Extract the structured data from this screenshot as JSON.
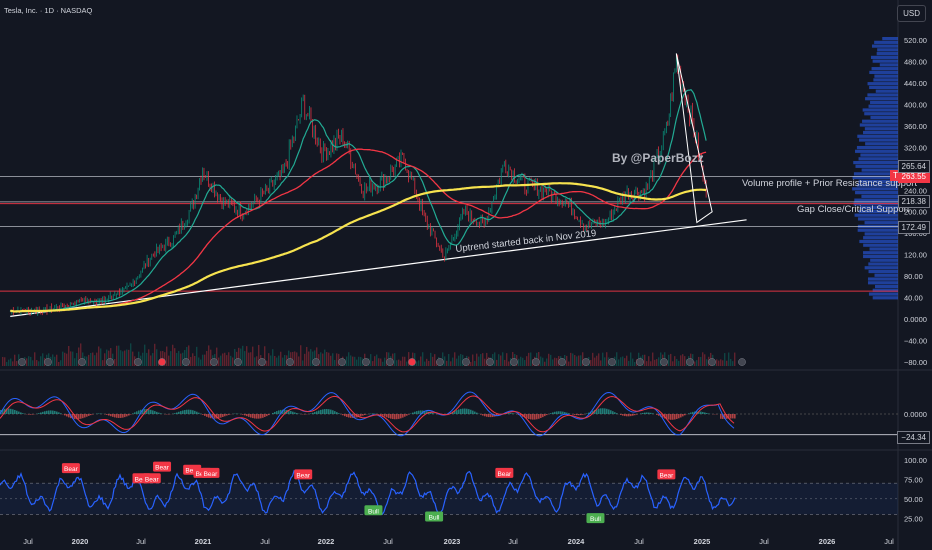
{
  "header": {
    "symbol_title": "Tesla, Inc. · 1D · NASDAQ",
    "currency": "USD"
  },
  "annotations": {
    "author": "By @PaperBozz",
    "uptrend": "Uptrend started back in Nov 2019",
    "volume_profile": "Volume profile + Prior Resistance support",
    "gap_close": "Gap Close/Critical Support"
  },
  "price_tags": {
    "current_ticker": "TSLA",
    "current": "263.55",
    "resistance": "265.64",
    "support": "218.38",
    "gap": "172.49",
    "macd_level": "−24.34"
  },
  "colors": {
    "background": "#131722",
    "price_line": "#d1d4dc",
    "ma_short": "#22ab94",
    "ma_mid": "#f23645",
    "ma_long": "#f7e34f",
    "trendline": "#ffffff",
    "horizontal_line": "#d1d4dc",
    "red_line": "#f23645",
    "volume_profile": "#2962ff",
    "rsi": "#2962ff",
    "bear_label": "#f23645",
    "bull_label": "#4caf50",
    "earnings_marker": "#f23645"
  },
  "chart_data": [
    {
      "type": "line",
      "pane": "price",
      "ylim": [
        -80,
        520
      ],
      "y_ticks": [
        "520.00",
        "480.00",
        "440.00",
        "400.00",
        "360.00",
        "320.00",
        "280.00",
        "240.00",
        "200.00",
        "160.00",
        "120.00",
        "80.00",
        "40.00",
        "0.0000",
        "−40.00",
        "−80.00"
      ],
      "x_ticks": [
        "Jul",
        "2020",
        "Jul",
        "2021",
        "Jul",
        "2022",
        "Jul",
        "2023",
        "Jul",
        "2024",
        "Jul",
        "2025",
        "Jul",
        "2026",
        "Jul"
      ],
      "series": [
        {
          "x": [
            "2019-06",
            "2019-09",
            "2019-11",
            "2020-01",
            "2020-03",
            "2020-06",
            "2020-08",
            "2020-10",
            "2020-12",
            "2021-01",
            "2021-03",
            "2021-05",
            "2021-07",
            "2021-09",
            "2021-11",
            "2022-01",
            "2022-03",
            "2022-05",
            "2022-07",
            "2022-09",
            "2022-11",
            "2023-01",
            "2023-03",
            "2023-05",
            "2023-07",
            "2023-09",
            "2023-11",
            "2024-01",
            "2024-03",
            "2024-05",
            "2024-07",
            "2024-09",
            "2024-11",
            "2024-12",
            "2025-01",
            "2025-02",
            "2025-03"
          ],
          "values": [
            15,
            16,
            22,
            35,
            32,
            63,
            120,
            145,
            210,
            280,
            220,
            200,
            230,
            270,
            400,
            310,
            340,
            240,
            260,
            300,
            190,
            115,
            200,
            175,
            290,
            250,
            240,
            220,
            175,
            180,
            235,
            240,
            350,
            480,
            410,
            330,
            230
          ]
        }
      ],
      "horizontal_levels": [
        265.64,
        218.38,
        215,
        172.49,
        52
      ],
      "trendline": {
        "from": {
          "x": "2019-06",
          "y": 5
        },
        "to": {
          "x": "2025-07",
          "y": 185
        }
      }
    },
    {
      "type": "line",
      "pane": "macd",
      "y_ticks": [
        "0.0000",
        "−24.34"
      ],
      "horizontal_levels": [
        0,
        -24.34
      ]
    },
    {
      "type": "line",
      "pane": "rsi",
      "ylim": [
        10,
        110
      ],
      "y_ticks": [
        "100.00",
        "75.00",
        "50.00",
        "25.00"
      ],
      "band": [
        30,
        70
      ],
      "signals": [
        {
          "label": "Bear",
          "x": "2019-12",
          "y": 88
        },
        {
          "label": "Bear",
          "x": "2020-07",
          "y": 75
        },
        {
          "label": "Bear",
          "x": "2020-08",
          "y": 75
        },
        {
          "label": "Bear",
          "x": "2020-09",
          "y": 90
        },
        {
          "label": "Bear",
          "x": "2020-12",
          "y": 86
        },
        {
          "label": "Bear",
          "x": "2021-01",
          "y": 82
        },
        {
          "label": "Bear",
          "x": "2021-01",
          "y": 82
        },
        {
          "label": "Bear",
          "x": "2021-11",
          "y": 80
        },
        {
          "label": "Bull",
          "x": "2022-06",
          "y": 34
        },
        {
          "label": "Bull",
          "x": "2022-12",
          "y": 26
        },
        {
          "label": "Bear",
          "x": "2023-07",
          "y": 82
        },
        {
          "label": "Bull",
          "x": "2024-04",
          "y": 24
        },
        {
          "label": "Bear",
          "x": "2024-11",
          "y": 80
        }
      ]
    }
  ]
}
